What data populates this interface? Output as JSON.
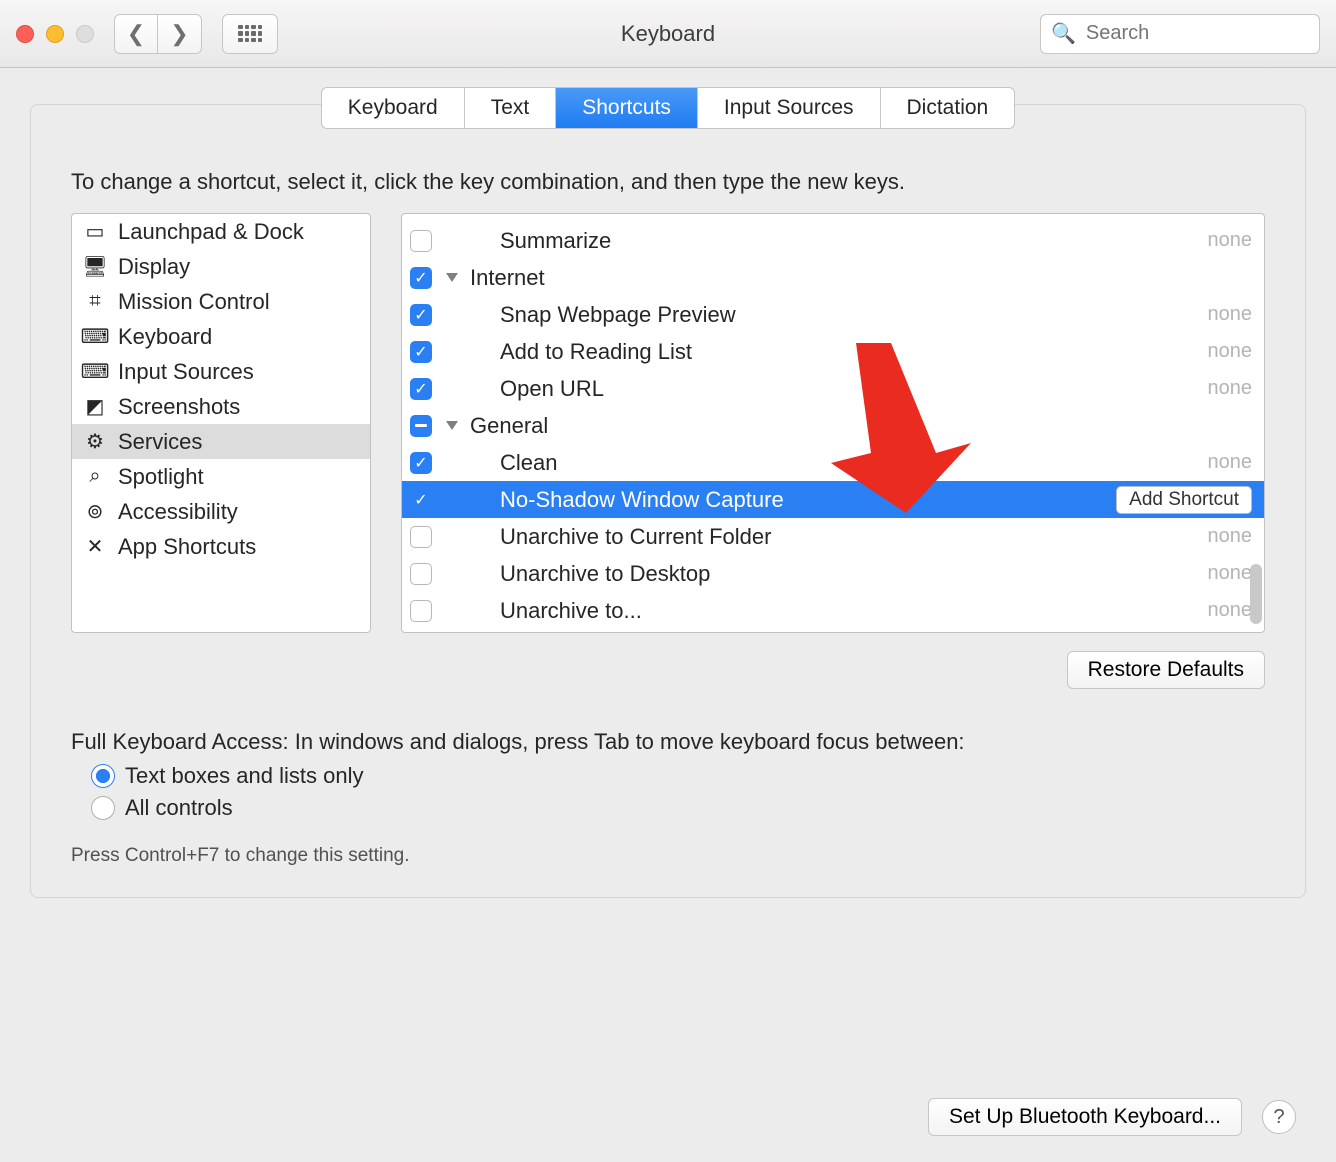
{
  "window": {
    "title": "Keyboard",
    "search_placeholder": "Search"
  },
  "tabs": [
    {
      "label": "Keyboard",
      "active": false
    },
    {
      "label": "Text",
      "active": false
    },
    {
      "label": "Shortcuts",
      "active": true
    },
    {
      "label": "Input Sources",
      "active": false
    },
    {
      "label": "Dictation",
      "active": false
    }
  ],
  "instructions": "To change a shortcut, select it, click the key combination, and then type the new keys.",
  "categories": [
    {
      "label": "Launchpad & Dock",
      "icon": "launchpad-icon",
      "glyph": "▭",
      "selected": false
    },
    {
      "label": "Display",
      "icon": "display-icon",
      "glyph": "🖥",
      "selected": false
    },
    {
      "label": "Mission Control",
      "icon": "mission-icon",
      "glyph": "⌗",
      "selected": false
    },
    {
      "label": "Keyboard",
      "icon": "keyboard-icon",
      "glyph": "⌨",
      "selected": false
    },
    {
      "label": "Input Sources",
      "icon": "inputsrc-icon",
      "glyph": "⌨",
      "selected": false
    },
    {
      "label": "Screenshots",
      "icon": "screenshots-icon",
      "glyph": "◩",
      "selected": false
    },
    {
      "label": "Services",
      "icon": "services-icon",
      "glyph": "⚙",
      "selected": true
    },
    {
      "label": "Spotlight",
      "icon": "spotlight-icon",
      "glyph": "⌕",
      "selected": false
    },
    {
      "label": "Accessibility",
      "icon": "accessibility-icon",
      "glyph": "⊚",
      "selected": false
    },
    {
      "label": "App Shortcuts",
      "icon": "appshortcuts-icon",
      "glyph": "✕",
      "selected": false
    }
  ],
  "shortcuts": [
    {
      "type": "item-nocheck",
      "label": "Summarize",
      "check": "none",
      "indent": 1,
      "value": "none",
      "selected": false
    },
    {
      "type": "group",
      "label": "Internet",
      "check": "checked",
      "indent": 0,
      "value": "",
      "selected": false
    },
    {
      "type": "item",
      "label": "Snap Webpage Preview",
      "check": "checked",
      "indent": 1,
      "value": "none",
      "selected": false
    },
    {
      "type": "item",
      "label": "Add to Reading List",
      "check": "checked",
      "indent": 1,
      "value": "none",
      "selected": false
    },
    {
      "type": "item",
      "label": "Open URL",
      "check": "checked",
      "indent": 1,
      "value": "none",
      "selected": false
    },
    {
      "type": "group",
      "label": "General",
      "check": "mixed",
      "indent": 0,
      "value": "",
      "selected": false
    },
    {
      "type": "item",
      "label": "Clean",
      "check": "checked",
      "indent": 1,
      "value": "none",
      "selected": false
    },
    {
      "type": "item",
      "label": "No-Shadow Window Capture",
      "check": "checked",
      "indent": 1,
      "value": "",
      "selected": true,
      "add_button": true
    },
    {
      "type": "item",
      "label": "Unarchive to Current Folder",
      "check": "none",
      "indent": 1,
      "value": "none",
      "selected": false
    },
    {
      "type": "item",
      "label": "Unarchive to Desktop",
      "check": "none",
      "indent": 1,
      "value": "none",
      "selected": false
    },
    {
      "type": "item",
      "label": "Unarchive to...",
      "check": "none",
      "indent": 1,
      "value": "none",
      "selected": false
    }
  ],
  "add_button_label": "Add Shortcut",
  "restore_button": "Restore Defaults",
  "fka_label": "Full Keyboard Access: In windows and dialogs, press Tab to move keyboard focus between:",
  "fka_options": [
    {
      "label": "Text boxes and lists only",
      "checked": true
    },
    {
      "label": "All controls",
      "checked": false
    }
  ],
  "fka_hint": "Press Control+F7 to change this setting.",
  "bluetooth_button": "Set Up Bluetooth Keyboard..."
}
